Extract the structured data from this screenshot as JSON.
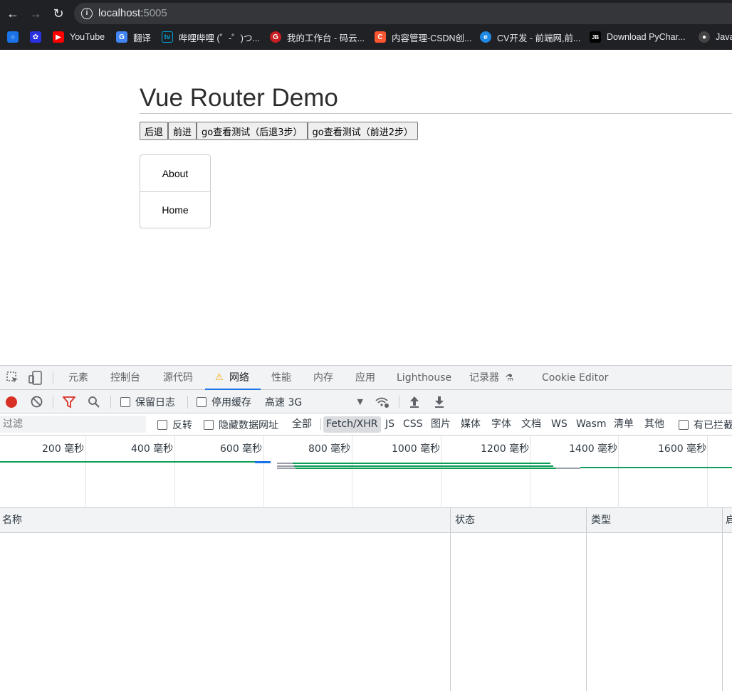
{
  "browser": {
    "url_host": "localhost:",
    "url_port": "5005",
    "bookmarks": [
      {
        "label": "",
        "icon": "apps-icon",
        "color": "#1a73e8"
      },
      {
        "label": "",
        "icon": "baidu-icon",
        "color": "#2932e1"
      },
      {
        "label": "YouTube",
        "icon": "youtube-icon",
        "color": "#ff0000"
      },
      {
        "label": "翻译",
        "icon": "translate-icon",
        "color": "#4285f4"
      },
      {
        "label": "哔哩哔哩 (゜-゜)つ...",
        "icon": "bilibili-icon",
        "color": "#00a1d6"
      },
      {
        "label": "我的工作台 - 码云...",
        "icon": "gitee-icon",
        "color": "#c71d23"
      },
      {
        "label": "内容管理-CSDN创...",
        "icon": "csdn-icon",
        "color": "#fc5531"
      },
      {
        "label": "CV开发 - 前端网,前...",
        "icon": "edge-icon",
        "color": "#1e88e5"
      },
      {
        "label": "Download PyChar...",
        "icon": "jetbrains-icon",
        "color": "#000000"
      },
      {
        "label": "Java",
        "icon": "java-icon",
        "color": "#444444"
      }
    ]
  },
  "page": {
    "title": "Vue Router Demo",
    "buttons": [
      "后退",
      "前进",
      "go查看测试（后退3步）",
      "go查看测试（前进2步）"
    ],
    "links": [
      "About",
      "Home"
    ]
  },
  "devtools": {
    "tabs": [
      "元素",
      "控制台",
      "源代码",
      "网络",
      "性能",
      "内存",
      "应用",
      "Lighthouse",
      "记录器",
      "Cookie Editor"
    ],
    "active_tab": "网络",
    "toolbar": {
      "preserve_log": "保留日志",
      "disable_cache": "停用缓存",
      "throttling": "高速 3G"
    },
    "filter": {
      "placeholder": "过滤",
      "invert": "反转",
      "hide_data_urls": "隐藏数据网址",
      "all": "全部",
      "types": [
        "Fetch/XHR",
        "JS",
        "CSS",
        "图片",
        "媒体",
        "字体",
        "文档",
        "WS",
        "Wasm",
        "清单",
        "其他"
      ],
      "selected_type": "Fetch/XHR",
      "blocked": "有已拦截"
    },
    "timeline_ticks": [
      "200 毫秒",
      "400 毫秒",
      "600 毫秒",
      "800 毫秒",
      "1000 毫秒",
      "1200 毫秒",
      "1400 毫秒",
      "1600 毫秒"
    ],
    "columns": [
      "名称",
      "状态",
      "类型",
      "启"
    ]
  }
}
